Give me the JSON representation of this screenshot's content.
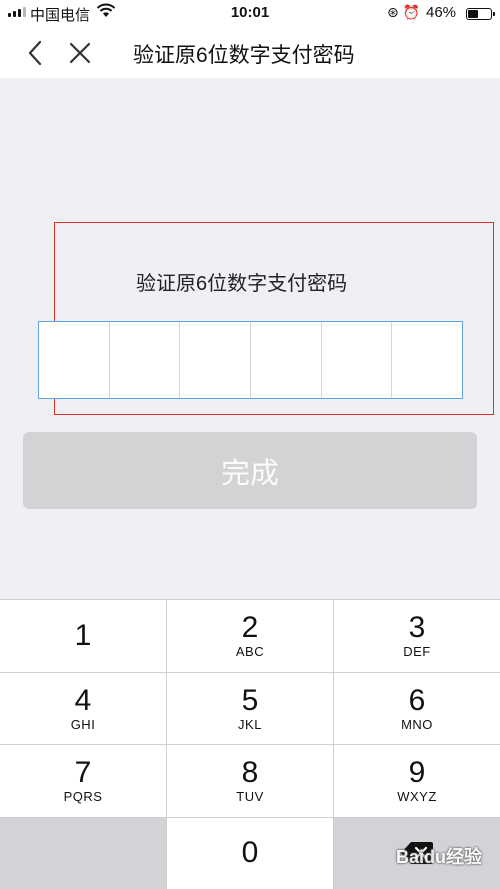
{
  "status_bar": {
    "carrier": "中国电信",
    "time": "10:01",
    "battery_percent": "46%",
    "battery_level": 0.46
  },
  "nav": {
    "title": "验证原6位数字支付密码",
    "back_icon": "chevron-left-icon",
    "close_icon": "close-icon"
  },
  "content": {
    "prompt": "验证原6位数字支付密码",
    "pin_cells": 6,
    "done_label": "完成"
  },
  "keypad": {
    "keys": [
      {
        "digit": "1",
        "letters": ""
      },
      {
        "digit": "2",
        "letters": "ABC"
      },
      {
        "digit": "3",
        "letters": "DEF"
      },
      {
        "digit": "4",
        "letters": "GHI"
      },
      {
        "digit": "5",
        "letters": "JKL"
      },
      {
        "digit": "6",
        "letters": "MNO"
      },
      {
        "digit": "7",
        "letters": "PQRS"
      },
      {
        "digit": "8",
        "letters": "TUV"
      },
      {
        "digit": "9",
        "letters": "WXYZ"
      }
    ],
    "zero": "0",
    "delete_icon": "backspace-icon"
  },
  "watermark": "Baidu经验",
  "colors": {
    "highlight": "#d9352e",
    "input_border": "#5ea6e0",
    "button_disabled": "#d3d3d6"
  }
}
